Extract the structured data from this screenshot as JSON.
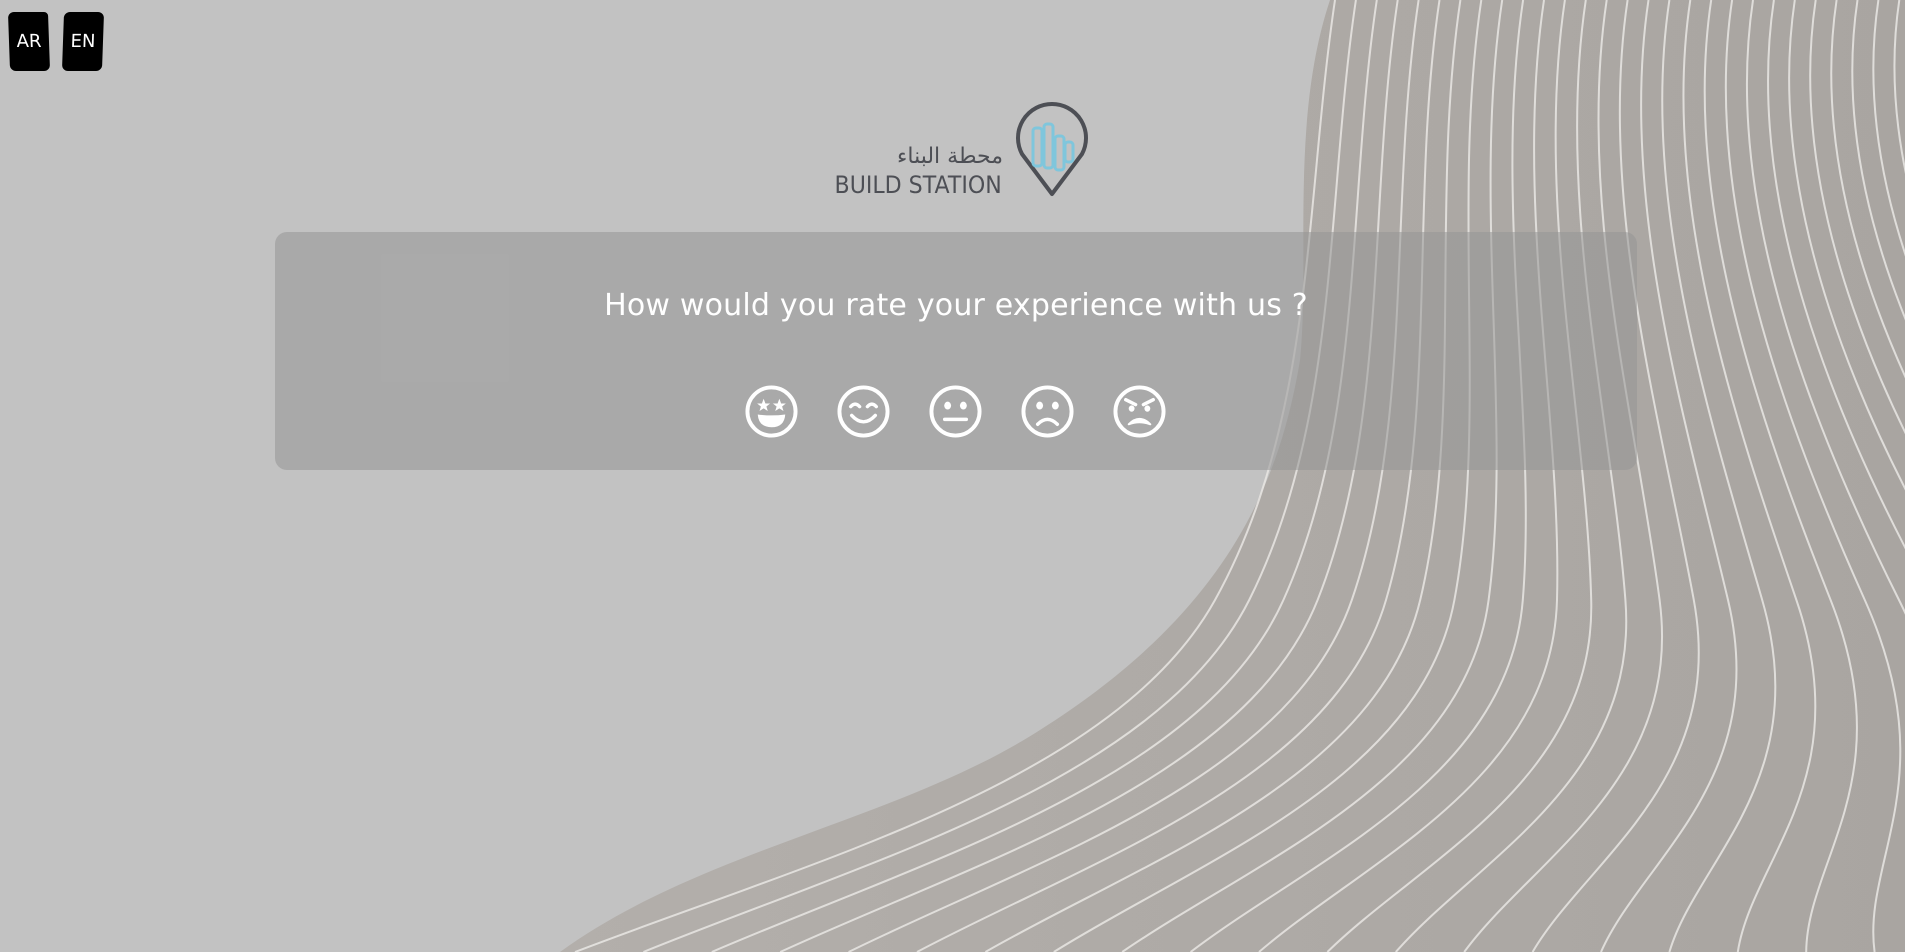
{
  "language_switcher": {
    "ar_label": "AR",
    "en_label": "EN"
  },
  "brand": {
    "name_ar": "محطة البناء",
    "name_en": "BUILD STATION"
  },
  "survey": {
    "question": "How would you rate your experience with us ?",
    "options": [
      {
        "icon": "star-struck-face-icon"
      },
      {
        "icon": "smiling-face-icon"
      },
      {
        "icon": "neutral-face-icon"
      },
      {
        "icon": "frowning-face-icon"
      },
      {
        "icon": "angry-face-icon"
      }
    ]
  },
  "colors": {
    "background": "#c2c2c2",
    "card": "#a6a6a6",
    "logo_text": "#4d4f55",
    "logo_accent": "#7fc6dc"
  }
}
